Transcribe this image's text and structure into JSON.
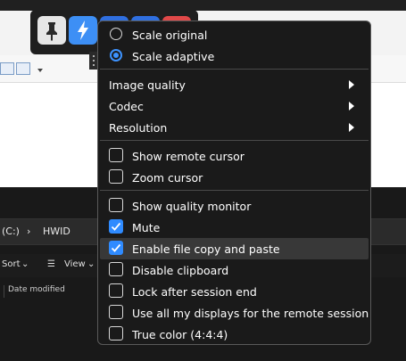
{
  "background": {
    "breadcrumb_drive": "(C:)",
    "breadcrumb_sep": "›",
    "breadcrumb_folder": "HWID",
    "sort_label": "Sort",
    "view_label": "View",
    "column_date_modified": "Date modified"
  },
  "toolbar": {
    "pin_icon": "pin-icon",
    "lightning_icon": "lightning-icon",
    "colors": {
      "pin_bg": "#e6e6e6",
      "lightning_bg": "#3d8ff5",
      "blue": "#2f6fe0",
      "red": "#e04848"
    }
  },
  "menu": {
    "scale_original": {
      "label": "Scale original",
      "selected": false
    },
    "scale_adaptive": {
      "label": "Scale adaptive",
      "selected": true
    },
    "image_quality": "Image quality",
    "codec": "Codec",
    "resolution": "Resolution",
    "show_remote_cursor": {
      "label": "Show remote cursor",
      "checked": false
    },
    "zoom_cursor": {
      "label": "Zoom cursor",
      "checked": false
    },
    "show_quality_monitor": {
      "label": "Show quality monitor",
      "checked": false
    },
    "mute": {
      "label": "Mute",
      "checked": true
    },
    "enable_file_copy": {
      "label": "Enable file copy and paste",
      "checked": true
    },
    "disable_clipboard": {
      "label": "Disable clipboard",
      "checked": false
    },
    "lock_after_session_end": {
      "label": "Lock after session end",
      "checked": false
    },
    "use_all_displays": {
      "label": "Use all my displays for the remote session",
      "checked": false
    },
    "true_color": {
      "label": "True color (4:4:4)",
      "checked": false
    }
  }
}
